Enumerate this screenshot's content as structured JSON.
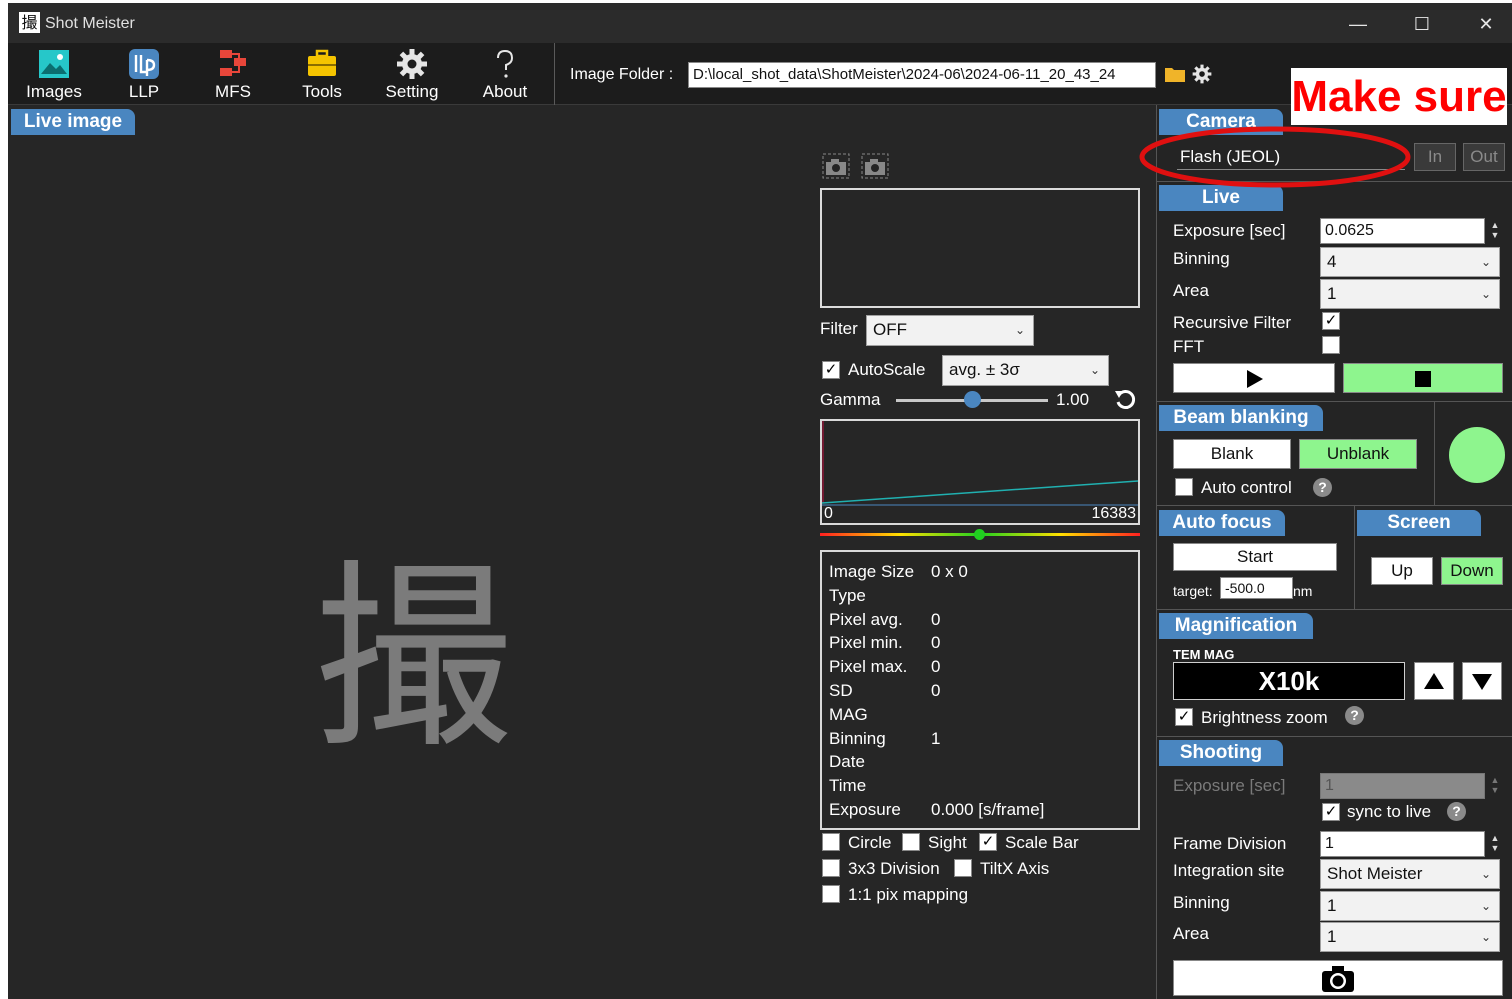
{
  "window": {
    "title": "Shot Meister",
    "icon_char": "撮",
    "minimize": "—",
    "maximize": "☐",
    "close": "✕"
  },
  "toolbar": {
    "items": [
      {
        "label": "Images",
        "icon": "image-icon"
      },
      {
        "label": "LLP",
        "icon": "llp-icon"
      },
      {
        "label": "MFS",
        "icon": "mfs-icon"
      },
      {
        "label": "Tools",
        "icon": "toolbox-icon"
      },
      {
        "label": "Setting",
        "icon": "gear-icon"
      },
      {
        "label": "About",
        "icon": "question-icon"
      }
    ],
    "folder_label": "Image Folder :",
    "folder_path": "D:\\local_shot_data\\ShotMeister\\2024-06\\2024-06-11_20_43_24"
  },
  "live": {
    "tab": "Live image",
    "watermark": "撮",
    "filter_label": "Filter",
    "filter_value": "OFF",
    "autoscale_label": "AutoScale",
    "autoscale_checked": true,
    "autoscale_mode": "avg. ± 3σ",
    "gamma_label": "Gamma",
    "gamma_value": "1.00",
    "histogram_min": "0",
    "histogram_max": "16383",
    "info": [
      {
        "k": "Image Size",
        "v": "0 x 0"
      },
      {
        "k": "Type",
        "v": ""
      },
      {
        "k": "Pixel avg.",
        "v": "0"
      },
      {
        "k": "Pixel min.",
        "v": "0"
      },
      {
        "k": "Pixel max.",
        "v": "0"
      },
      {
        "k": "SD",
        "v": "0"
      },
      {
        "k": "MAG",
        "v": ""
      },
      {
        "k": "Binning",
        "v": "1"
      },
      {
        "k": "Date",
        "v": ""
      },
      {
        "k": "Time",
        "v": ""
      },
      {
        "k": "Exposure",
        "v": "0.000 [s/frame]"
      }
    ],
    "overlay_options": {
      "circle": "Circle",
      "sight": "Sight",
      "scale_bar": "Scale Bar",
      "division": "3x3 Division",
      "tiltx": "TiltX Axis",
      "pix_mapping": "1:1 pix mapping"
    }
  },
  "camera": {
    "tab": "Camera",
    "name": "Flash (JEOL)",
    "in_label": "In",
    "out_label": "Out"
  },
  "live_panel": {
    "tab": "Live",
    "exposure_label": "Exposure [sec]",
    "exposure_value": "0.0625",
    "binning_label": "Binning",
    "binning_value": "4",
    "area_label": "Area",
    "area_value": "1",
    "recursive_label": "Recursive Filter",
    "recursive_checked": true,
    "fft_label": "FFT",
    "fft_checked": false
  },
  "beam_blanking": {
    "tab": "Beam blanking",
    "blank_label": "Blank",
    "unblank_label": "Unblank",
    "auto_label": "Auto control",
    "status_color": "#8ef58e"
  },
  "auto_focus": {
    "tab": "Auto focus",
    "start_label": "Start",
    "target_label": "target:",
    "target_value": "-500.0",
    "unit": "nm"
  },
  "screen": {
    "tab": "Screen",
    "up_label": "Up",
    "down_label": "Down"
  },
  "magnification": {
    "tab": "Magnification",
    "mode": "TEM MAG",
    "value": "X10k",
    "brightness_label": "Brightness zoom",
    "brightness_checked": true
  },
  "shooting": {
    "tab": "Shooting",
    "exposure_label": "Exposure [sec]",
    "exposure_value": "1",
    "sync_label": "sync to live",
    "sync_checked": true,
    "frame_label": "Frame Division",
    "frame_value": "1",
    "site_label": "Integration site",
    "site_value": "Shot Meister",
    "binning_label": "Binning",
    "binning_value": "1",
    "area_label": "Area",
    "area_value": "1"
  },
  "annotation": {
    "text": "Make sure",
    "color": "#ff0000"
  },
  "colors": {
    "accent_tab": "#4a86c0",
    "green_button": "#8ef58e",
    "background": "#242424"
  }
}
